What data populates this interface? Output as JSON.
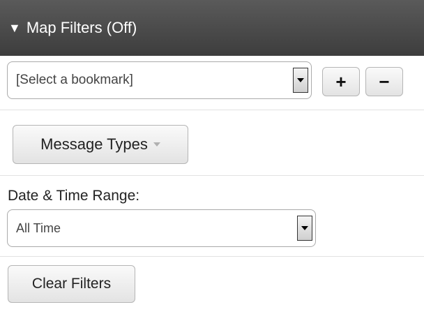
{
  "header": {
    "toggle_glyph": "▼",
    "title": "Map Filters (Off)"
  },
  "bookmark": {
    "selected": "[Select a bookmark]",
    "add_symbol": "+",
    "remove_symbol": "−"
  },
  "message_types": {
    "label": "Message Types"
  },
  "date_range": {
    "label": "Date & Time Range:",
    "selected": "All Time"
  },
  "clear_filters": {
    "label": "Clear Filters"
  },
  "icons": {
    "toggle": "triangle-down-icon",
    "select_arrow": "chevron-down-icon",
    "add": "plus-icon",
    "remove": "minus-icon",
    "dropdown_caret": "caret-down-icon"
  },
  "colors": {
    "header_bg": "#4a4a4a",
    "header_text": "#ffffff"
  }
}
